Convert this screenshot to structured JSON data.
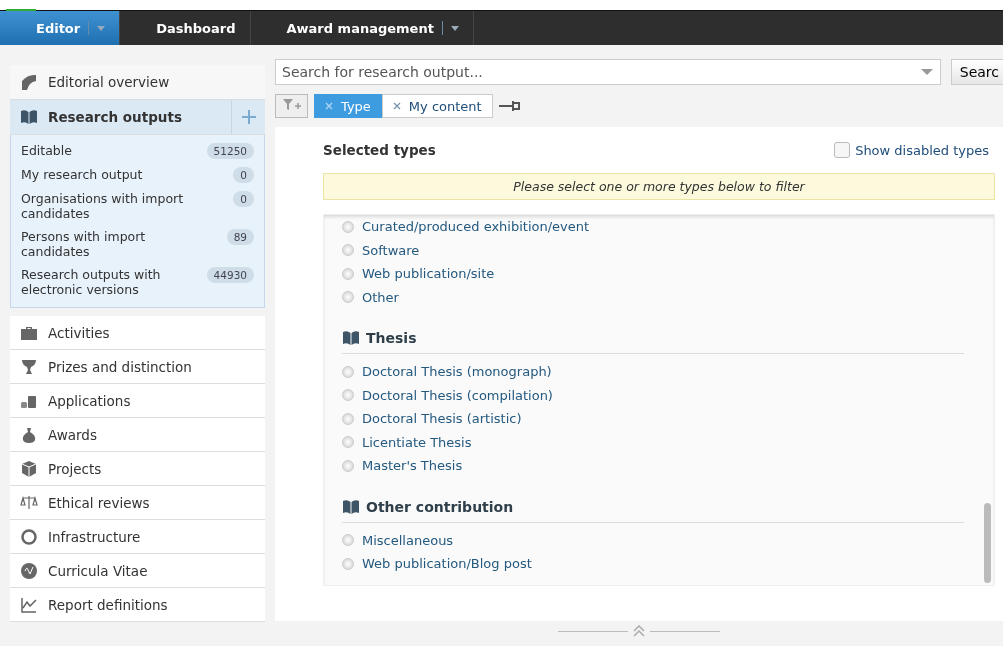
{
  "top_nav": [
    {
      "label": "Editor",
      "selected": true,
      "dropdown": true
    },
    {
      "label": "Dashboard",
      "selected": false,
      "dropdown": false
    },
    {
      "label": "Award management",
      "selected": false,
      "dropdown": true
    }
  ],
  "sidebar": {
    "overview": {
      "label": "Editorial overview"
    },
    "current": {
      "label": "Research outputs"
    },
    "subitems": [
      {
        "label": "Editable",
        "count": "51250"
      },
      {
        "label": "My research output",
        "count": "0"
      },
      {
        "label": "Organisations with import candidates",
        "count": "0"
      },
      {
        "label": "Persons with import candidates",
        "count": "89"
      },
      {
        "label": "Research outputs with electronic versions",
        "count": "44930"
      }
    ],
    "items": [
      {
        "label": "Activities"
      },
      {
        "label": "Prizes and distinction"
      },
      {
        "label": "Applications"
      },
      {
        "label": "Awards"
      },
      {
        "label": "Projects"
      },
      {
        "label": "Ethical reviews"
      },
      {
        "label": "Infrastructure"
      },
      {
        "label": "Curricula Vitae"
      },
      {
        "label": "Report definitions"
      }
    ]
  },
  "search": {
    "placeholder": "Search for research output...",
    "button": "Searc"
  },
  "filters": [
    {
      "label": "Type",
      "selected": true
    },
    {
      "label": "My content",
      "selected": false
    }
  ],
  "types_panel": {
    "title": "Selected types",
    "show_disabled": {
      "label": "Show disabled types",
      "checked": false
    },
    "notice": "Please select one or more types below to filter",
    "groups": [
      {
        "items": [
          {
            "label": "Curated/produced exhibition/event",
            "checked": false
          },
          {
            "label": "Software",
            "checked": false
          },
          {
            "label": "Web publication/site",
            "checked": false
          },
          {
            "label": "Other",
            "checked": false
          }
        ]
      },
      {
        "title": "Thesis",
        "items": [
          {
            "label": "Doctoral Thesis (monograph)",
            "checked": false
          },
          {
            "label": "Doctoral Thesis (compilation)",
            "checked": false
          },
          {
            "label": "Doctoral Thesis (artistic)",
            "checked": false
          },
          {
            "label": "Licentiate Thesis",
            "checked": false
          },
          {
            "label": "Master's Thesis",
            "checked": false
          }
        ]
      },
      {
        "title": "Other contribution",
        "items": [
          {
            "label": "Miscellaneous",
            "checked": false
          },
          {
            "label": "Web publication/Blog post",
            "checked": false
          }
        ]
      }
    ]
  }
}
